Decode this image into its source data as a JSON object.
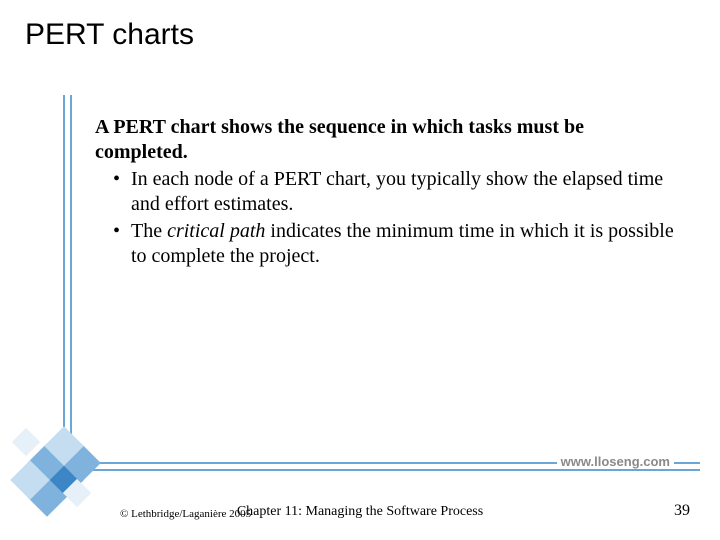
{
  "title": "PERT charts",
  "content": {
    "lead": "A PERT chart shows the sequence in which tasks must be completed.",
    "bullets": [
      {
        "pre": "In each node of a PERT chart, you typically show the elapsed time and effort estimates."
      },
      {
        "pre": "The ",
        "em": "critical path",
        "post": " indicates the minimum time in which it is possible to complete the project."
      }
    ]
  },
  "url": "www.lloseng.com",
  "footer": {
    "left": "© Lethbridge/Laganière 2005",
    "center": "Chapter 11: Managing the Software Process",
    "right": "39"
  }
}
